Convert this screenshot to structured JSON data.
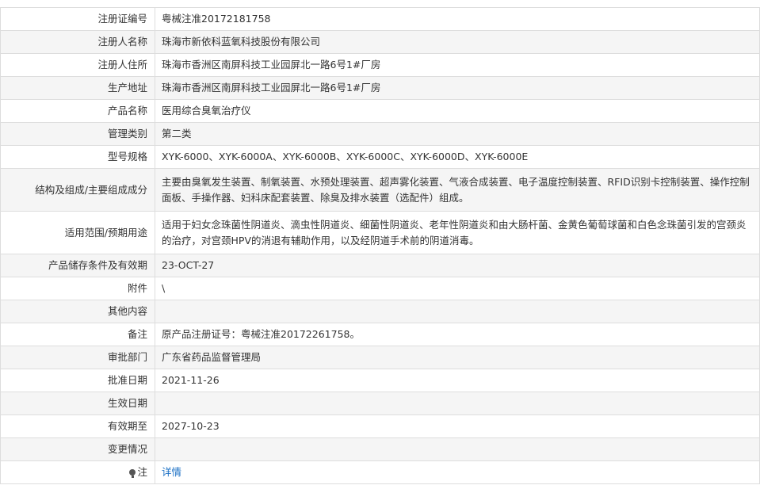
{
  "rows": [
    {
      "label": "注册证编号",
      "value": "粤械注准20172181758"
    },
    {
      "label": "注册人名称",
      "value": "珠海市新依科蓝氧科技股份有限公司"
    },
    {
      "label": "注册人住所",
      "value": "珠海市香洲区南屏科技工业园屏北一路6号1#厂房"
    },
    {
      "label": "生产地址",
      "value": "珠海市香洲区南屏科技工业园屏北一路6号1#厂房"
    },
    {
      "label": "产品名称",
      "value": "医用综合臭氧治疗仪"
    },
    {
      "label": "管理类别",
      "value": "第二类"
    },
    {
      "label": "型号规格",
      "value": "XYK-6000、XYK-6000A、XYK-6000B、XYK-6000C、XYK-6000D、XYK-6000E"
    },
    {
      "label": "结构及组成/主要组成成分",
      "value": "主要由臭氧发生装置、制氧装置、水预处理装置、超声雾化装置、气液合成装置、电子温度控制装置、RFID识别卡控制装置、操作控制面板、手操作器、妇科床配套装置、除臭及排水装置（选配件）组成。"
    },
    {
      "label": "适用范围/预期用途",
      "value": "适用于妇女念珠菌性阴道炎、滴虫性阴道炎、细菌性阴道炎、老年性阴道炎和由大肠杆菌、金黄色葡萄球菌和白色念珠菌引发的宫颈炎的治疗，对宫颈HPV的消退有辅助作用，以及经阴道手术前的阴道消毒。"
    },
    {
      "label": "产品储存条件及有效期",
      "value": "23-OCT-27"
    },
    {
      "label": "附件",
      "value": "\\"
    },
    {
      "label": "其他内容",
      "value": ""
    },
    {
      "label": "备注",
      "value": "原产品注册证号：粤械注准20172261758。"
    },
    {
      "label": "审批部门",
      "value": "广东省药品监督管理局"
    },
    {
      "label": "批准日期",
      "value": "2021-11-26"
    },
    {
      "label": "生效日期",
      "value": ""
    },
    {
      "label": "有效期至",
      "value": "2027-10-23"
    },
    {
      "label": "变更情况",
      "value": ""
    },
    {
      "label": "注",
      "value": "详情",
      "icon": "lightbulb-icon"
    }
  ],
  "colors": {
    "border": "#dddddd",
    "stripe": "#f5f5f5",
    "link": "#1a6fc4",
    "text": "#333333"
  }
}
